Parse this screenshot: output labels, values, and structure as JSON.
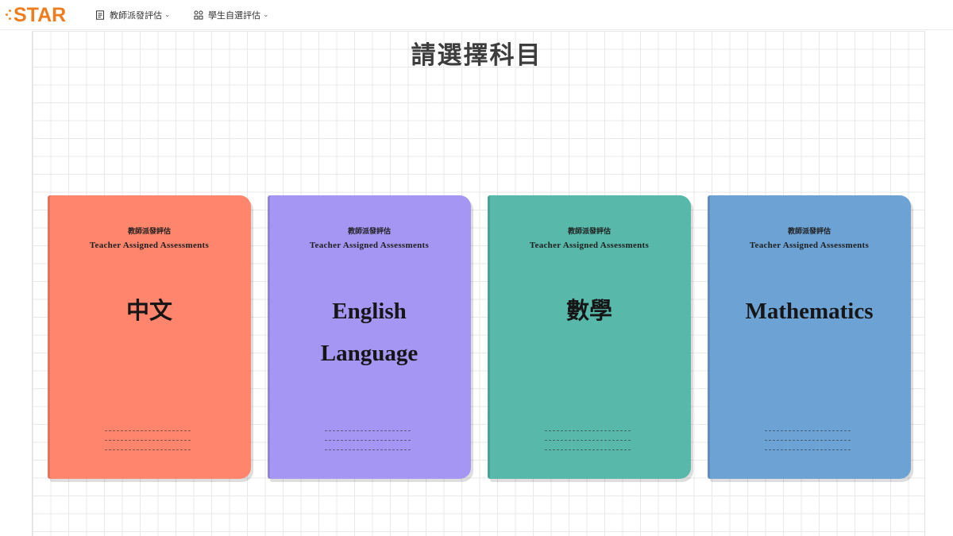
{
  "header": {
    "logo_text": "STAR",
    "nav": [
      {
        "label": "教師派發評估",
        "icon": "document-icon"
      },
      {
        "label": "學生自選評估",
        "icon": "apps-icon"
      }
    ]
  },
  "main": {
    "title": "請選擇科目",
    "books": [
      {
        "kicker_zh": "教師派發評估",
        "kicker_en": "Teacher Assigned Assessments",
        "subject": [
          "中文"
        ],
        "color": "#ff866d"
      },
      {
        "kicker_zh": "教師派發評估",
        "kicker_en": "Teacher Assigned Assessments",
        "subject": [
          "English",
          "Language"
        ],
        "color": "#a696f3"
      },
      {
        "kicker_zh": "教師派發評估",
        "kicker_en": "Teacher Assigned Assessments",
        "subject": [
          "數學"
        ],
        "color": "#58b8a9"
      },
      {
        "kicker_zh": "教師派發評估",
        "kicker_en": "Teacher Assigned Assessments",
        "subject": [
          "Mathematics"
        ],
        "color": "#6da2d4"
      }
    ]
  },
  "colors": {
    "brand": "#ef7d1e",
    "grid_line": "#e9e9e9",
    "title_text": "#3d3d3d"
  }
}
